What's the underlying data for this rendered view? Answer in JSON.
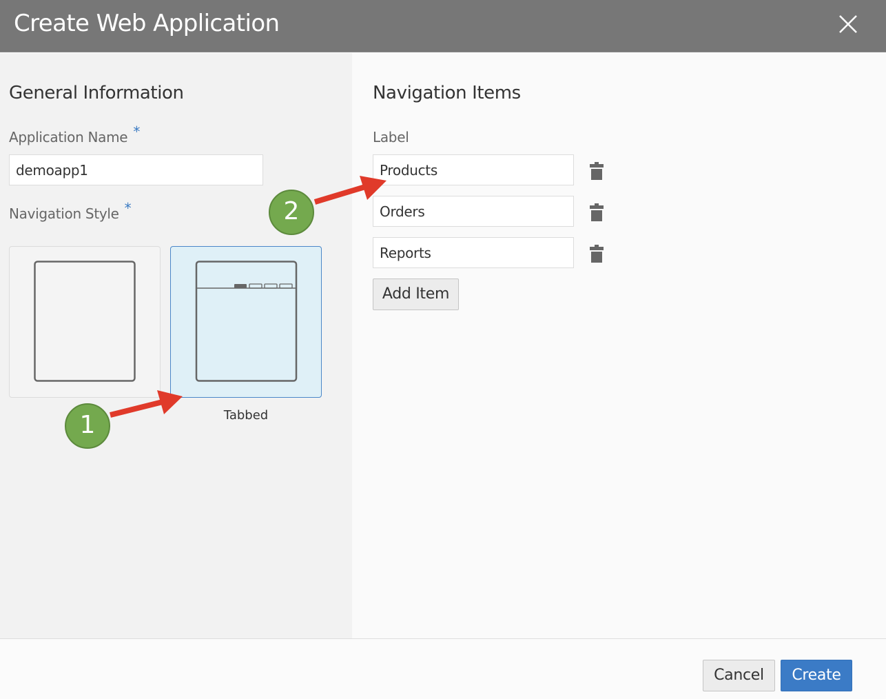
{
  "dialog": {
    "title": "Create Web Application",
    "close_icon": "close-icon"
  },
  "general": {
    "heading": "General Information",
    "app_name_label": "Application Name",
    "required_marker": "*",
    "app_name_value": "demoapp1",
    "nav_style_label": "Navigation Style",
    "styles": [
      {
        "name": "blank",
        "caption": "",
        "selected": false
      },
      {
        "name": "tabbed",
        "caption": "Tabbed",
        "selected": true
      }
    ]
  },
  "navigation": {
    "heading": "Navigation Items",
    "column_label": "Label",
    "items": [
      {
        "label": "Products",
        "delete_icon": "trash-icon"
      },
      {
        "label": "Orders",
        "delete_icon": "trash-icon"
      },
      {
        "label": "Reports",
        "delete_icon": "trash-icon"
      }
    ],
    "add_button": "Add Item"
  },
  "footer": {
    "cancel": "Cancel",
    "create": "Create"
  },
  "callouts": [
    {
      "number": "1"
    },
    {
      "number": "2"
    }
  ],
  "colors": {
    "header_bg": "#777777",
    "primary": "#3b7bc6",
    "selected_card_bg": "#dff0f7",
    "callout_green": "#74a94e",
    "arrow_red": "#e03a2a"
  }
}
